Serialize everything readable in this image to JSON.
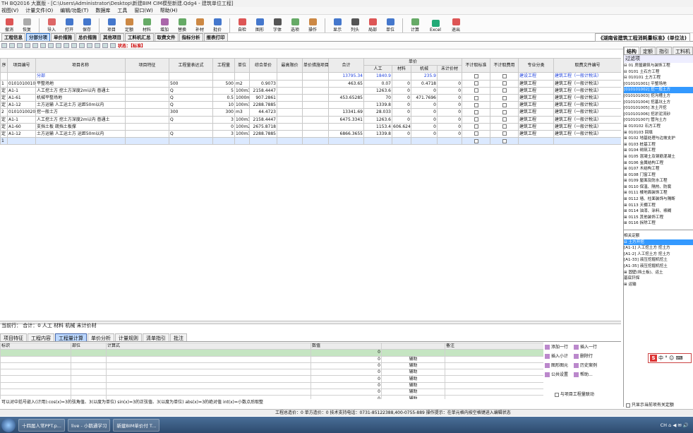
{
  "app": {
    "title": "TH BQ2016 大赢版 - [C:\\Users\\Administrator\\Desktop\\新建BIM CIM模型新建.Qdg4 - 建筑单位工程]"
  },
  "menu": [
    "视图(V)",
    "计量文件(O)",
    "编辑/功能(T)",
    "数据库",
    "工具",
    "窗口(W)",
    "帮助(H)"
  ],
  "toolbar": [
    {
      "icon": "undo-icon",
      "label": "撤消",
      "color": "#d55"
    },
    {
      "icon": "redo-icon",
      "label": "恢复",
      "color": "#aaa"
    },
    {
      "icon": "import-icon",
      "label": "导入",
      "color": "#d66"
    },
    {
      "icon": "open-icon",
      "label": "打开",
      "color": "#47c"
    },
    {
      "icon": "save-icon",
      "label": "保存",
      "color": "#47c"
    },
    {
      "icon": "project-icon",
      "label": "项目",
      "color": "#47c"
    },
    {
      "icon": "quota-icon",
      "label": "定额",
      "color": "#c84"
    },
    {
      "icon": "material-icon",
      "label": "材料",
      "color": "#6a6"
    },
    {
      "icon": "calc-icon",
      "label": "增加",
      "color": "#a6a"
    },
    {
      "icon": "sheet-icon",
      "label": "替换",
      "color": "#6a6"
    },
    {
      "icon": "replace-icon",
      "label": "补材",
      "color": "#c84"
    },
    {
      "icon": "batch-icon",
      "label": "批价",
      "color": "#47c"
    },
    {
      "icon": "auto-icon",
      "label": "自检",
      "color": "#d55"
    },
    {
      "icon": "view-icon",
      "label": "图形",
      "color": "#47c"
    },
    {
      "icon": "font-icon",
      "label": "字体",
      "color": "#555"
    },
    {
      "icon": "merge-icon",
      "label": "选项",
      "color": "#6a6"
    },
    {
      "icon": "op-icon",
      "label": "操作",
      "color": "#c84"
    },
    {
      "icon": "display-icon",
      "label": "显示",
      "color": "#47c"
    },
    {
      "icon": "column-icon",
      "label": "列头",
      "color": "#555"
    },
    {
      "icon": "label-icon",
      "label": "局部",
      "color": "#d55"
    },
    {
      "icon": "unit-icon",
      "label": "单位",
      "color": "#47c"
    },
    {
      "icon": "sum-icon",
      "label": "计算",
      "color": "#6a6"
    },
    {
      "icon": "excel-icon",
      "label": "Excel",
      "color": "#2a7"
    },
    {
      "icon": "exit-icon",
      "label": "退出",
      "color": "#d55"
    }
  ],
  "tabs": [
    "工程信息",
    "分部分项",
    "单价措施",
    "总价措施",
    "其他项目",
    "工料机汇总",
    "取费文件",
    "指标分析",
    "报表打印"
  ],
  "active_tab": "分部分项",
  "project_name": "《湖南省建筑工程消耗量标准》(单位法)",
  "status_label": "状态：【标准】",
  "grid": {
    "headers": [
      "序",
      "项目编号",
      "项目名称",
      "项目特征",
      "工程量表达式",
      "工程量",
      "单位",
      "综合单价",
      "最高限价",
      "单价措施项目",
      "合计",
      "人工",
      "材料",
      "机械",
      "未计价材",
      "不计取标准",
      "不计取费用",
      "专业分类",
      "取费文件编号"
    ],
    "subheader": "单价",
    "rows": [
      {
        "seq": "",
        "code": "",
        "name": "分部",
        "feature": "",
        "expr": "",
        "qty": "",
        "unit": "",
        "price": "",
        "limit": "",
        "mf": "",
        "total": "13795.34",
        "lab": "1840.9",
        "mat": "",
        "mach": "235.9",
        "unp": "",
        "c1": false,
        "c2": false,
        "pro": "建设工程",
        "fee": "建筑工程（一般计税法）",
        "kind": "bl"
      },
      {
        "seq": "1",
        "code": "0101010010",
        "name": "平整场地",
        "feature": "",
        "expr": "500",
        "qty": "500",
        "unit": "m2",
        "price": "0.9073",
        "limit": "",
        "mf": "",
        "total": "463.65",
        "lab": "0.07",
        "mat": "0",
        "mach": "0.4718",
        "unp": "0",
        "c1": false,
        "c2": false,
        "pro": "建筑工程",
        "fee": "建筑工程（一般计税法）",
        "kind": "n"
      },
      {
        "seq": "定",
        "code": "A1-1",
        "name": "人工挖土方 挖土方深度2m以内 普通土",
        "feature": "",
        "expr": "Q",
        "qty": "5",
        "unit": "100m3",
        "price": "2158.4447",
        "limit": "",
        "mf": "",
        "total": "",
        "lab": "1263.6",
        "mat": "0",
        "mach": "0",
        "unp": "0",
        "c1": false,
        "c2": false,
        "pro": "建筑工程",
        "fee": "建筑工程（一般计税法）",
        "kind": "n"
      },
      {
        "seq": "定",
        "code": "A1-61",
        "name": "机械平整场地",
        "feature": "",
        "expr": "Q",
        "qty": "0.5",
        "unit": "1000m2",
        "price": "907.2861",
        "limit": "",
        "mf": "",
        "total": "453.65285",
        "lab": "70",
        "mat": "0",
        "mach": "471.7696",
        "unp": "0",
        "c1": false,
        "c2": false,
        "pro": "建筑工程",
        "fee": "建筑工程（一般计税法）",
        "kind": "n"
      },
      {
        "seq": "定",
        "code": "A1-12",
        "name": "土方运输 人工运土方 运距50m以内",
        "feature": "",
        "expr": "Q",
        "qty": "10",
        "unit": "100m3",
        "price": "2288.7885",
        "limit": "",
        "mf": "",
        "total": "",
        "lab": "1339.8",
        "mat": "0",
        "mach": "0",
        "unp": "0",
        "c1": false,
        "c2": false,
        "pro": "建筑工程",
        "fee": "建筑工程（一般计税法）",
        "kind": "n"
      },
      {
        "seq": "2",
        "code": "0101010020",
        "name": "挖一般土方",
        "feature": "",
        "expr": "300",
        "qty": "300",
        "unit": "m3",
        "price": "44.4723",
        "limit": "",
        "mf": "",
        "total": "13341.69",
        "lab": "28.033",
        "mat": "0",
        "mach": "0",
        "unp": "0",
        "c1": false,
        "c2": false,
        "pro": "建筑工程",
        "fee": "建筑工程（一般计税法）",
        "kind": "n"
      },
      {
        "seq": "定",
        "code": "A1-1",
        "name": "人工挖土方 挖土方深度2m以内 普通土",
        "feature": "",
        "expr": "Q",
        "qty": "3",
        "unit": "100m3",
        "price": "2158.4447",
        "limit": "",
        "mf": "",
        "total": "6475.3341",
        "lab": "1263.6",
        "mat": "0",
        "mach": "0",
        "unp": "0",
        "c1": false,
        "c2": false,
        "pro": "建筑工程",
        "fee": "建筑工程（一般计税法）",
        "kind": "n"
      },
      {
        "seq": "定",
        "code": "A1-60",
        "name": "支挡土板 疏挡土板撑",
        "feature": "",
        "expr": "",
        "qty": "0",
        "unit": "100m2",
        "price": "2675.8718",
        "limit": "",
        "mf": "",
        "total": "",
        "lab": "1153.4",
        "mat": "606.624",
        "mach": "0",
        "unp": "0",
        "c1": false,
        "c2": false,
        "pro": "建筑工程",
        "fee": "建筑工程（一般计税法）",
        "kind": "n"
      },
      {
        "seq": "定",
        "code": "A1-12",
        "name": "土方运输 人工运土方 运距50m以内",
        "feature": "",
        "expr": "Q",
        "qty": "3",
        "unit": "100m3",
        "price": "2288.7885",
        "limit": "",
        "mf": "",
        "total": "6866.3655",
        "lab": "1339.8",
        "mat": "0",
        "mach": "0",
        "unp": "0",
        "c1": false,
        "c2": false,
        "pro": "建筑工程",
        "fee": "建筑工程（一般计税法）",
        "kind": "n"
      },
      {
        "seq": "1",
        "code": "",
        "name": "",
        "feature": "",
        "expr": "",
        "qty": "",
        "unit": "",
        "price": "",
        "limit": "",
        "mf": "",
        "total": "",
        "lab": "",
        "mat": "",
        "mach": "",
        "unp": "",
        "c1": false,
        "c2": false,
        "pro": "",
        "fee": "",
        "kind": "cur"
      }
    ]
  },
  "right_panel": {
    "tabs": [
      "结构",
      "定额",
      "指引",
      "工料机"
    ],
    "active": "结构",
    "filter_label": "过滤项",
    "tree1": [
      {
        "t": "⊟ 01 房屋建筑与装饰工程",
        "sel": false
      },
      {
        "t": "  ⊟ 0101 土石方工程",
        "sel": false
      },
      {
        "t": "    ⊟ 010101 土方工程",
        "sel": false
      },
      {
        "t": "      [010101001] 平整场地",
        "sel": false
      },
      {
        "t": "      [010101002] 挖一般土方",
        "sel": true
      },
      {
        "t": "      [010101003] 挖沟槽土方",
        "sel": false
      },
      {
        "t": "      [010101004] 挖基坑土方",
        "sel": false
      },
      {
        "t": "      [010101005] 冻土开挖",
        "sel": false
      },
      {
        "t": "      [010101006] 挖淤泥流砂",
        "sel": false
      },
      {
        "t": "      [010101007] 管沟土方",
        "sel": false
      },
      {
        "t": "    ⊞ 010102 石方工程",
        "sel": false
      },
      {
        "t": "    ⊞ 010103 回填",
        "sel": false
      },
      {
        "t": "  ⊞ 0102 地基处理与边坡支护",
        "sel": false
      },
      {
        "t": "  ⊞ 0103 桩基工程",
        "sel": false
      },
      {
        "t": "  ⊞ 0104 砌筑工程",
        "sel": false
      },
      {
        "t": "  ⊞ 0105 混凝土及钢筋混凝土",
        "sel": false
      },
      {
        "t": "  ⊞ 0106 金属结构工程",
        "sel": false
      },
      {
        "t": "  ⊞ 0107 木结构工程",
        "sel": false
      },
      {
        "t": "  ⊞ 0108 门窗工程",
        "sel": false
      },
      {
        "t": "  ⊞ 0109 屋面及防水工程",
        "sel": false
      },
      {
        "t": "  ⊞ 0110 保温、隔热、防腐",
        "sel": false
      },
      {
        "t": "  ⊞ 0111 楼地面装饰工程",
        "sel": false
      },
      {
        "t": "  ⊞ 0112 墙、柱面装饰与隔断",
        "sel": false
      },
      {
        "t": "  ⊞ 0113 天棚工程",
        "sel": false
      },
      {
        "t": "  ⊞ 0114 油漆、涂料、裱糊",
        "sel": false
      },
      {
        "t": "  ⊞ 0115 其他装饰工程",
        "sel": false
      },
      {
        "t": "  ⊞ 0116 拆除工程",
        "sel": false
      }
    ],
    "tree2_title": "相关定额",
    "tree2": [
      {
        "t": "⊟ 土方开挖",
        "sel": true
      },
      {
        "t": "  [A1-1] 人工挖土方 挖土方",
        "sel": false
      },
      {
        "t": "  [A1-2] 人工挖土方 挖土方",
        "sel": false
      },
      {
        "t": "  [A1-33] 液压挖掘机挖土",
        "sel": false
      },
      {
        "t": "  [A1-35] 液压挖掘机挖土",
        "sel": false
      },
      {
        "t": "⊞ 固壁(挡土板)、运土",
        "sel": false
      },
      {
        "t": "  基底钎探",
        "sel": false
      },
      {
        "t": "⊞ 运输",
        "sel": false
      }
    ],
    "bottom_check": "只显示当前项有关定额"
  },
  "summary_bar": "当前行： 合计：0  人工  材料  机械  未计价材",
  "bottom_tabs": [
    "项目特征",
    "工程内容",
    "工程量计算",
    "单价分析",
    "计量规则",
    "清单指引",
    "批注"
  ],
  "bottom_active": "工程量计算",
  "bottom_grid": {
    "headers": [
      "标识",
      "部位",
      "计算式",
      "",
      "数值",
      "",
      "备注"
    ],
    "rows": [
      {
        "a": "",
        "b": "",
        "c": "",
        "d": "",
        "e": "0",
        "f": "",
        "g": "",
        "green": true
      },
      {
        "a": "",
        "b": "",
        "c": "",
        "d": "",
        "e": "0",
        "f": "辅助",
        "g": "",
        "green": false
      },
      {
        "a": "",
        "b": "",
        "c": "",
        "d": "",
        "e": "0",
        "f": "辅助",
        "g": "",
        "green": false
      },
      {
        "a": "",
        "b": "",
        "c": "",
        "d": "",
        "e": "0",
        "f": "辅助",
        "g": "",
        "green": false
      },
      {
        "a": "",
        "b": "",
        "c": "",
        "d": "",
        "e": "0",
        "f": "辅助",
        "g": "",
        "green": false
      },
      {
        "a": "",
        "b": "",
        "c": "",
        "d": "",
        "e": "0",
        "f": "辅助",
        "g": "",
        "green": false
      },
      {
        "a": "",
        "b": "",
        "c": "",
        "d": "",
        "e": "0",
        "f": "辅助",
        "g": "",
        "green": false
      },
      {
        "a": "",
        "b": "",
        "c": "",
        "d": "",
        "e": "0",
        "f": "辅助",
        "g": "",
        "green": false
      }
    ]
  },
  "bottom_buttons": [
    [
      "添加一行",
      "插入一行"
    ],
    [
      "插入小计",
      "删除行"
    ],
    [
      "图形图元",
      "历史案例"
    ],
    [
      "公共设置",
      "帮助..."
    ]
  ],
  "link_label": "与项目工程量联动",
  "hint": "可以对中括号嵌入(计用):cos(x)=3的弦角值、3(以度为单位) sin(x)=3的正弦值、3(以度为单位) abs(x)=3的绝对值 int(x)=小数点后取整",
  "status_text": "工程总造价：0  单方造价：0  技术支持电话：0731-85122388,400-0755-889  操作提示：在单元格内按空格键进入编辑状态",
  "taskbar": {
    "buttons": [
      "十四届人常PPT.p...",
      "live - 小鹅通学习",
      "新建BIM单价付 T..."
    ],
    "tray": "CH ⌂ ◀ ✉ 🔊"
  },
  "ime_text": "中 ° ☺ ⌨"
}
